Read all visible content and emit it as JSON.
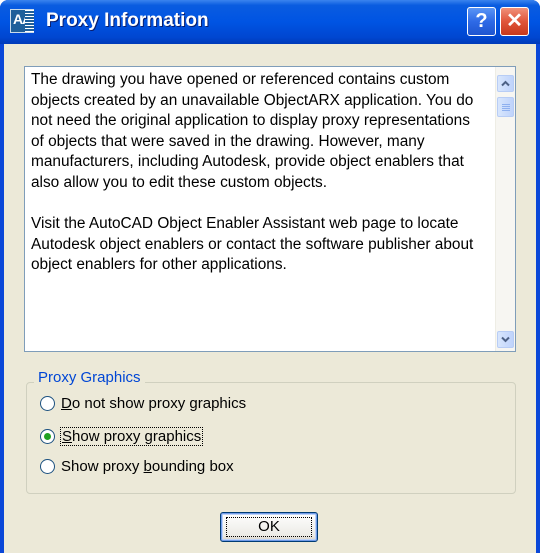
{
  "window": {
    "title": "Proxy Information",
    "icon": "autocad-app-icon",
    "icon_text": "AA",
    "help_label": "?",
    "close_label": "✕"
  },
  "message": {
    "paragraphs": [
      "The drawing you have opened or referenced contains custom objects created by an unavailable ObjectARX application. You do not need the original application to display proxy representations of objects that were saved in the drawing. However, many manufacturers, including Autodesk, provide object enablers that also allow you to edit these custom objects.",
      "Visit the AutoCAD Object Enabler Assistant web page to locate Autodesk object enablers or contact the software publisher about object enablers for other applications."
    ]
  },
  "proxy_graphics": {
    "group_label": "Proxy Graphics",
    "options": [
      {
        "label_pre": "",
        "label_u": "D",
        "label_post": "o not show proxy graphics",
        "selected": false
      },
      {
        "label_pre": "",
        "label_u": "S",
        "label_post": "how proxy graphics",
        "selected": true
      },
      {
        "label_pre": "Show proxy ",
        "label_u": "b",
        "label_post": "ounding box",
        "selected": false
      }
    ]
  },
  "buttons": {
    "ok_label": "OK"
  },
  "colors": {
    "titlebar": "#0054e3",
    "group_label": "#0046d5",
    "radio_selected": "#21a121",
    "dialog_bg": "#ece9d8"
  }
}
